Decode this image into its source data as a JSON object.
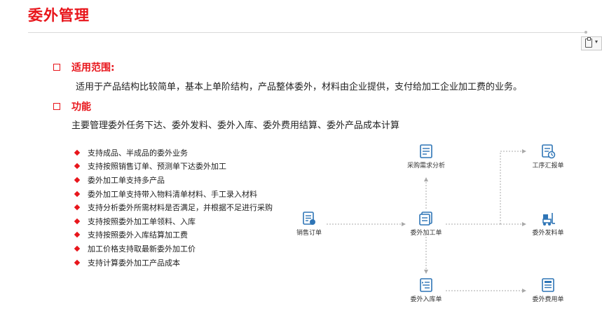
{
  "title": "委外管理",
  "section1": {
    "heading": "适用范围:",
    "text": "适用于产品结构比较简单，基本上单阶结构，产品整体委外，材料由企业提供，支付给加工企业加工费的业务。"
  },
  "section2": {
    "heading": "功能",
    "text": "主要管理委外任务下达、委外发料、委外入库、委外费用结算、委外产品成本计算"
  },
  "features": [
    "支持成品、半成品的委外业务",
    "支持按照销售订单、预测单下达委外加工",
    "委外加工单支持多产品",
    "委外加工单支持带入物料清单材料、手工录入材料",
    "支持分析委外所需材料是否满足，并根据不足进行采购",
    "支持按照委外加工单领料、入库",
    "支持按照委外入库结算加工费",
    "加工价格支持取最新委外加工价",
    "支持计算委外加工产品成本"
  ],
  "flow": {
    "sales_order": "销售订单",
    "purchase_analysis": "采购需求分析",
    "outsource_order": "委外加工单",
    "process_report": "工序汇报单",
    "outsource_issue": "委外发料单",
    "outsource_receipt": "委外入库单",
    "outsource_fee": "委外费用单"
  },
  "colors": {
    "accent": "#e8151b",
    "icon": "#2e75b6"
  }
}
